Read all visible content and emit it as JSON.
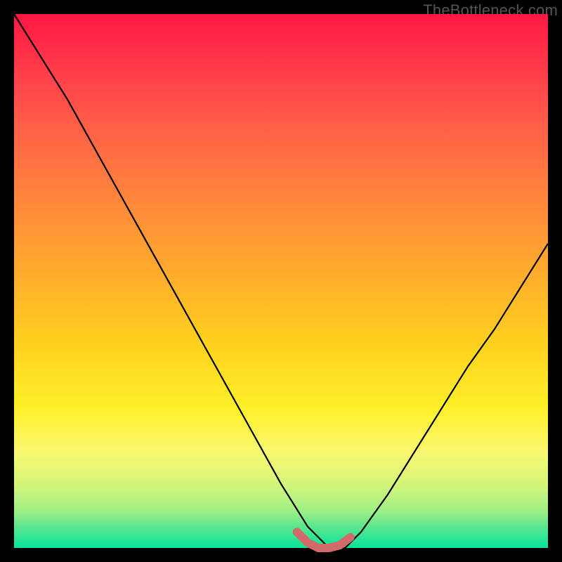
{
  "watermark": "TheBottleneck.com",
  "colors": {
    "page_bg": "#000000",
    "curve_black": "#000000",
    "bottom_band": "#d26a6a",
    "gradient_top": "#ff1744",
    "gradient_bottom": "#07e499"
  },
  "chart_data": {
    "type": "line",
    "title": "",
    "xlabel": "",
    "ylabel": "",
    "xlim": [
      0,
      100
    ],
    "ylim": [
      0,
      100
    ],
    "grid": false,
    "legend": false,
    "annotations": [
      "TheBottleneck.com"
    ],
    "series": [
      {
        "name": "curve",
        "x": [
          0,
          5,
          10,
          15,
          20,
          25,
          30,
          35,
          40,
          45,
          50,
          55,
          59,
          62,
          65,
          70,
          75,
          80,
          85,
          90,
          95,
          100
        ],
        "values": [
          100,
          92,
          84,
          75,
          66,
          57,
          48,
          39,
          30,
          21,
          12,
          4,
          0,
          0,
          3,
          10,
          18,
          26,
          34,
          41,
          49,
          57
        ]
      },
      {
        "name": "bottom-band",
        "x": [
          53,
          55,
          57,
          59,
          61,
          63
        ],
        "values": [
          3,
          1,
          0,
          0,
          0.5,
          2
        ]
      }
    ]
  }
}
